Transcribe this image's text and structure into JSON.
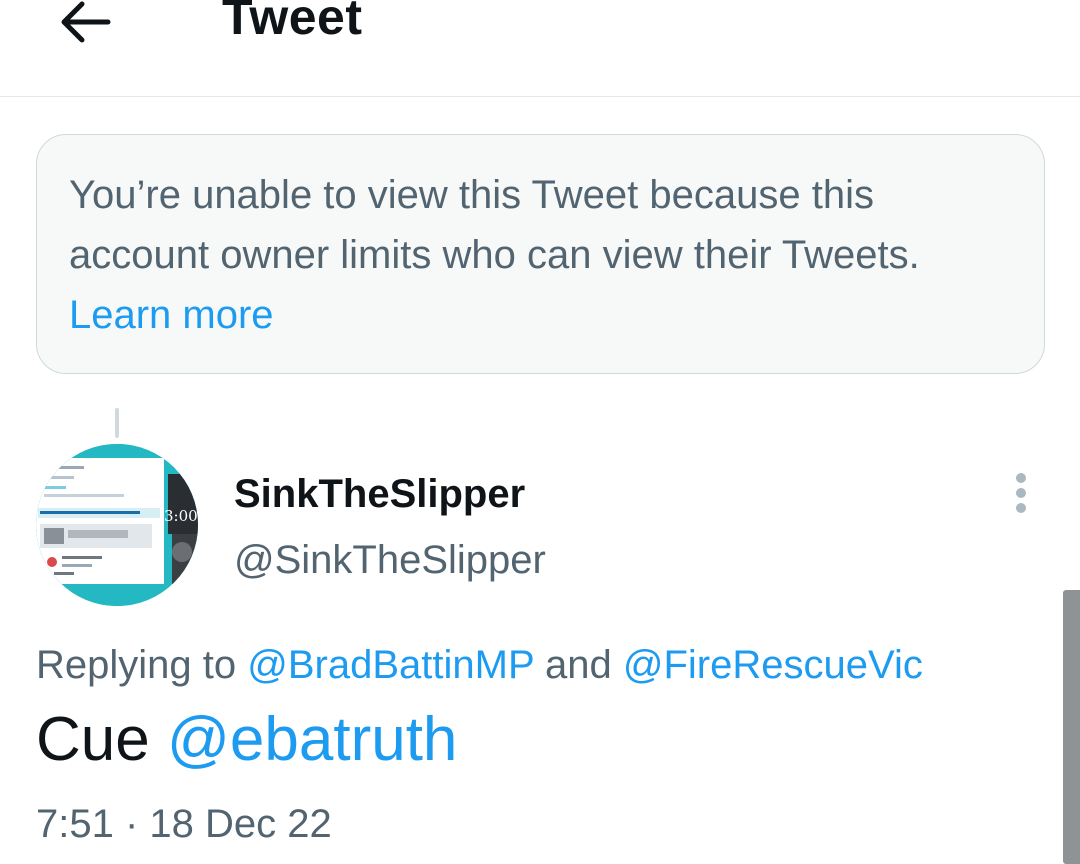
{
  "header": {
    "title": "Tweet",
    "back_icon": "arrow-left-icon"
  },
  "notice": {
    "text": "You’re unable to view this Tweet because this account owner limits who can view their Tweets. ",
    "link_label": "Learn more"
  },
  "tweet": {
    "author": {
      "display_name": "SinkTheSlipper",
      "handle": "@SinkTheSlipper",
      "avatar_icon": "profile-avatar",
      "avatar_overlay_text": "3:00"
    },
    "more_icon": "more-vertical-icon",
    "replying": {
      "prefix": "Replying to ",
      "mention_1": "@BradBattinMP",
      "joiner": " and ",
      "mention_2": "@FireRescueVic"
    },
    "text": {
      "prefix": "Cue ",
      "mention": "@ebatruth"
    },
    "time": "7:51",
    "separator": " · ",
    "date": "18 Dec 22"
  },
  "colors": {
    "accent": "#1d9bf0",
    "muted": "#536471",
    "text": "#0f1419",
    "notice_bg": "#f7f9f9",
    "avatar_teal": "#24b8c2"
  }
}
